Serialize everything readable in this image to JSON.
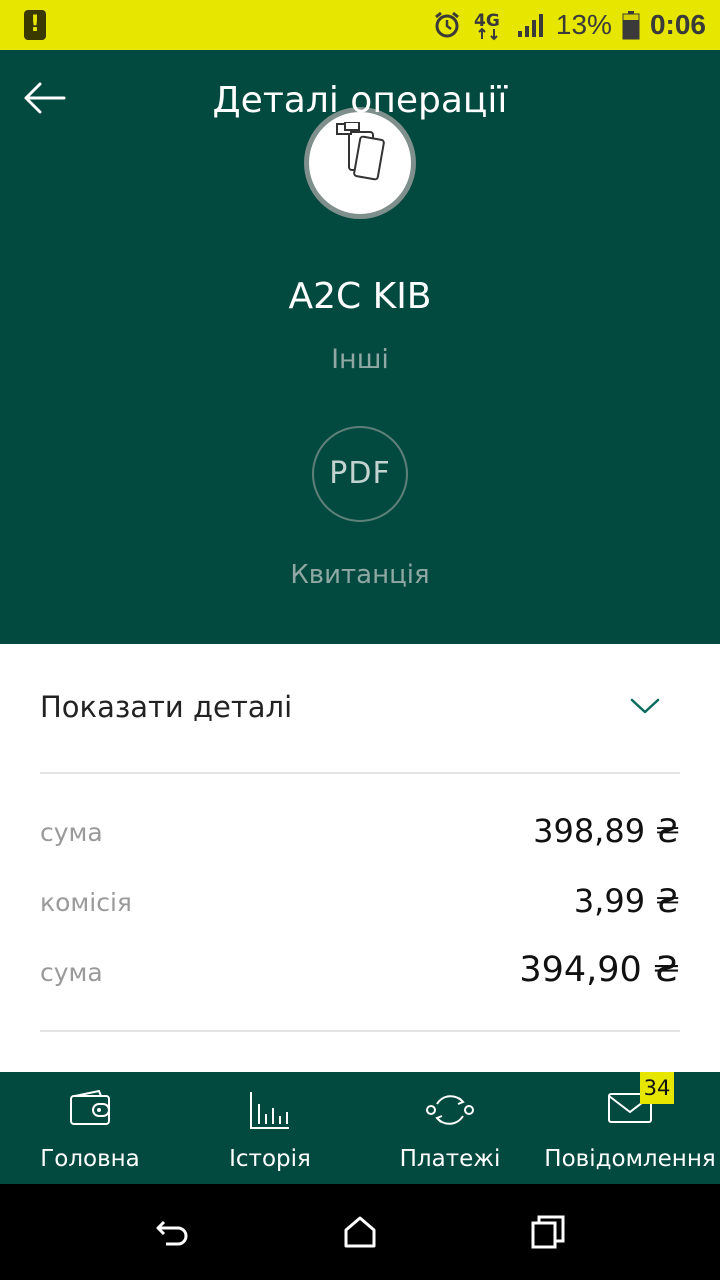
{
  "status_bar": {
    "battery_percent": "13%",
    "time": "0:06",
    "network": "4G",
    "icons": [
      "warning-icon",
      "alarm-icon",
      "4g-icon",
      "signal-icon",
      "battery-icon"
    ],
    "background_color": "#e6e600"
  },
  "header": {
    "title": "Деталі операції",
    "back_icon": "back-arrow-icon",
    "background_color": "#02493f"
  },
  "operation": {
    "merchant": "A2C KIB",
    "category": "Інші",
    "logo_icon": "wallet-cards-icon",
    "receipt_button": "PDF",
    "receipt_label": "Квитанція"
  },
  "details": {
    "toggle_label": "Показати деталі",
    "toggle_icon": "chevron-down-icon",
    "rows": [
      {
        "label": "сума",
        "value": "398,89 ₴"
      },
      {
        "label": "комісія",
        "value": "3,99 ₴"
      },
      {
        "label": "сума",
        "value": "394,90 ₴"
      }
    ]
  },
  "bottom_nav": {
    "items": [
      {
        "label": "Головна",
        "icon": "wallet-icon"
      },
      {
        "label": "Історія",
        "icon": "bar-chart-icon"
      },
      {
        "label": "Платежі",
        "icon": "exchange-icon"
      },
      {
        "label": "Повідомлення",
        "icon": "envelope-icon"
      }
    ],
    "messages_badge": "34"
  },
  "system_nav": {
    "icons": [
      "back-icon",
      "home-icon",
      "recents-icon"
    ]
  }
}
